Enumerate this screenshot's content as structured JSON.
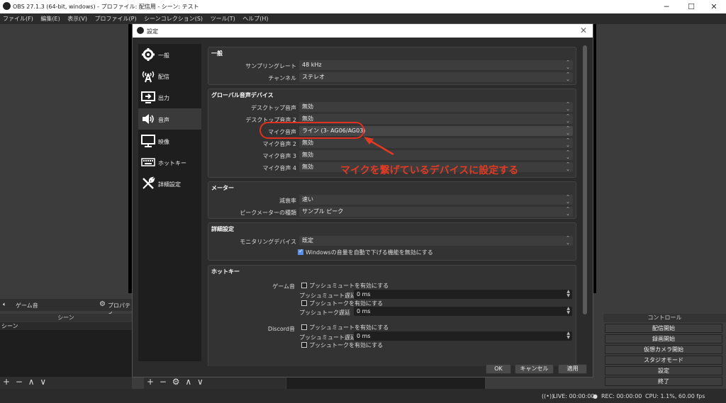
{
  "window": {
    "title": "OBS 27.1.3 (64-bit, windows) - プロファイル: 配信用 - シーン: テスト"
  },
  "menu": [
    "ファイル(F)",
    "編集(E)",
    "表示(V)",
    "プロファイル(P)",
    "シーンコレクション(S)",
    "ツール(T)",
    "ヘルプ(H)"
  ],
  "main": {
    "audio_label": "ゲーム音",
    "props_label": "プロパティ",
    "scenes_header": "シーン",
    "scene_item": "シーン",
    "controls_header": "コントロール",
    "controls": [
      "配信開始",
      "録画開始",
      "仮想カメラ開始",
      "スタジオモード",
      "設定",
      "終了"
    ]
  },
  "status": {
    "live": "LIVE: 00:00:00",
    "rec": "REC: 00:00:00",
    "cpu": "CPU: 1.1%, 60.00 fps"
  },
  "dialog": {
    "title": "設定",
    "nav": [
      "一般",
      "配信",
      "出力",
      "音声",
      "映像",
      "ホットキー",
      "詳細設定"
    ],
    "active_nav": "音声",
    "general": {
      "title": "一般",
      "sample_rate_label": "サンプリングレート",
      "sample_rate": "48 kHz",
      "channel_label": "チャンネル",
      "channel": "ステレオ"
    },
    "global": {
      "title": "グローバル音声デバイス",
      "rows": [
        {
          "label": "デスクトップ音声",
          "value": "無効"
        },
        {
          "label": "デスクトップ音声 2",
          "value": "無効"
        },
        {
          "label": "マイク音声",
          "value": "ライン (3- AG06/AG03)"
        },
        {
          "label": "マイク音声 2",
          "value": "無効"
        },
        {
          "label": "マイク音声 3",
          "value": "無効"
        },
        {
          "label": "マイク音声 4",
          "value": "無効"
        }
      ]
    },
    "meter": {
      "title": "メーター",
      "decay_label": "減衰率",
      "decay": "速い",
      "peak_label": "ピークメーターの種類",
      "peak": "サンプル ピーク"
    },
    "advanced": {
      "title": "詳細設定",
      "monitor_label": "モニタリングデバイス",
      "monitor": "既定",
      "ducking_text": "Windowsの音量を自動で下げる機能を無効にする"
    },
    "hotkeys": {
      "title": "ホットキー",
      "game_label": "ゲーム音",
      "discord_label": "Discord音",
      "pm_enable": "プッシュミュートを有効にする",
      "pm_delay": "プッシュミュート遅延",
      "pt_enable": "プッシュトークを有効にする",
      "pt_delay": "プッシュトーク遅延",
      "ms": "0 ms"
    },
    "buttons": {
      "ok": "OK",
      "cancel": "キャンセル",
      "apply": "適用"
    }
  },
  "annotation": {
    "text": "マイクを繋げているデバイスに設定する"
  },
  "colors": {
    "annotation": "#e23a23",
    "checkbox": "#5a8de8"
  }
}
